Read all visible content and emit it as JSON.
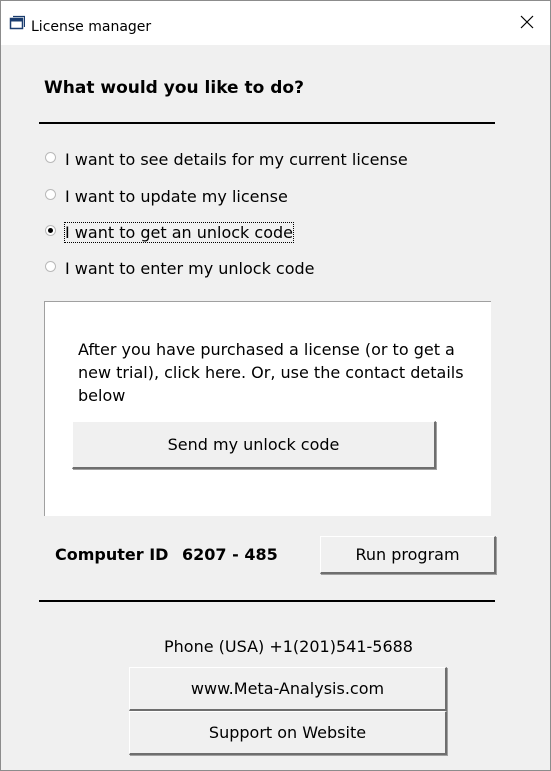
{
  "window": {
    "title": "License manager",
    "close_glyph": "✕"
  },
  "heading": "What would you like to do?",
  "options": [
    {
      "label": "I want to see details for my current license",
      "checked": false
    },
    {
      "label": "I want to update my license",
      "checked": false
    },
    {
      "label": "I want to get an unlock code",
      "checked": true
    },
    {
      "label": "I want to enter my unlock code",
      "checked": false
    }
  ],
  "panel": {
    "description": "After you have purchased a license (or to get a new trial), click here.  Or, use the contact details below",
    "button_label": "Send my unlock code"
  },
  "computer_id": {
    "label": "Computer ID",
    "value": "6207 - 485"
  },
  "run_button_label": "Run program",
  "contact": {
    "phone": "Phone (USA) +1(201)541-5688",
    "website_button": "www.Meta-Analysis.com",
    "support_button": "Support on Website"
  },
  "icons": {
    "app": "app-window-icon",
    "close": "close-icon"
  }
}
